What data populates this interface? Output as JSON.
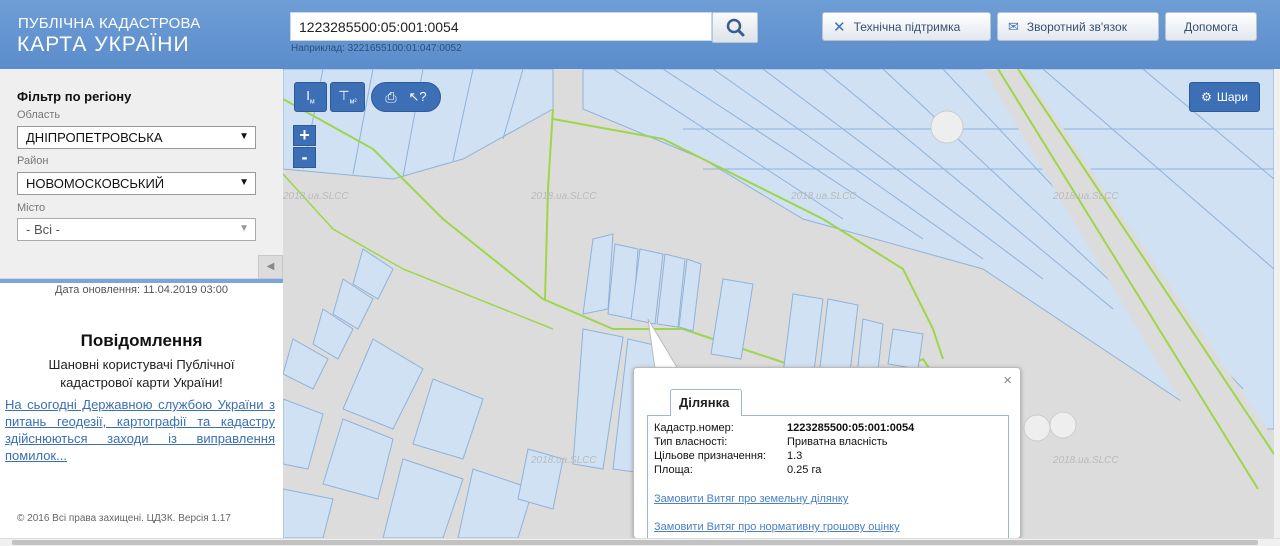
{
  "header": {
    "logo_line1": "ПУБЛІЧНА КАДАСТРОВА",
    "logo_line2": "КАРТА УКРАЇНИ",
    "search_value": "1223285500:05:001:0054",
    "search_hint": "Наприклад: 3221655100:01:047:0052",
    "support_label": "Технічна підтримка",
    "feedback_label": "Зворотний зв'язок",
    "help_label": "Допомога"
  },
  "sidebar": {
    "filter_title": "Фільтр по регіону",
    "oblast_label": "Область",
    "oblast_value": "ДНІПРОПЕТРОВСЬКА",
    "rayon_label": "Район",
    "rayon_value": "НОВОМОСКОВСЬКИЙ",
    "city_label": "Місто",
    "city_value": "- Всі -",
    "update_date": "Дата оновлення: 11.04.2019 03:00",
    "message_title": "Повідомлення",
    "message_text": "Шановні користувачі Публічної кадастрової карти України!",
    "message_link": "На сьогодні Державною службою України з питань геодезії, картографії та кадастру здійснюються заходи із виправлення помилок...",
    "copyright": "© 2016 Всі права захищені. ЦДЗК. Версія 1.17"
  },
  "map": {
    "layers_label": "Шари",
    "zoom_in": "+",
    "zoom_out": "-",
    "watermark": "2018.ua.SLCC"
  },
  "popup": {
    "tab_label": "Ділянка",
    "close": "×",
    "rows": [
      {
        "label": "Кадастр.номер:",
        "value": "1223285500:05:001:0054"
      },
      {
        "label": "Тип власності:",
        "value": "Приватна власність"
      },
      {
        "label": "Цільове призначення:",
        "value": "1.3"
      },
      {
        "label": "Площа:",
        "value": "0.25 га"
      }
    ],
    "link1": "Замовити Витяг про земельну ділянку",
    "link2": "Замовити Витяг про нормативну грошову оцінку"
  },
  "colors": {
    "header": "#5b8ccb",
    "button": "#3d6fb6",
    "parcel_fill": "#cfe1f3",
    "parcel_stroke": "#8fb3d9",
    "boundary": "#9ed64a"
  }
}
